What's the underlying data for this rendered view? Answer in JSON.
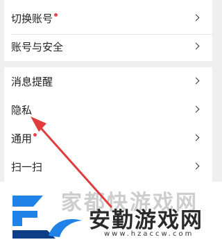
{
  "settings": {
    "group1": [
      {
        "label": "切换账号",
        "badge_dot": true
      },
      {
        "label": "账号与安全",
        "badge_dot": false
      }
    ],
    "group2": [
      {
        "label": "消息提醒",
        "badge_dot": false
      },
      {
        "label": "隐私",
        "badge_dot": false
      },
      {
        "label": "通用",
        "badge_dot": true
      },
      {
        "label": "扫一扫",
        "badge_dot": false
      }
    ]
  },
  "watermark": {
    "title": "安勤游戏网",
    "faded_title": "家都快游戏网",
    "url": "www.hzaccw.com"
  },
  "colors": {
    "badge_dot": "#e5484d",
    "arrow": "#e03c3c",
    "logo_blue": "#1e82e6",
    "logo_navy": "#0e3f86"
  }
}
